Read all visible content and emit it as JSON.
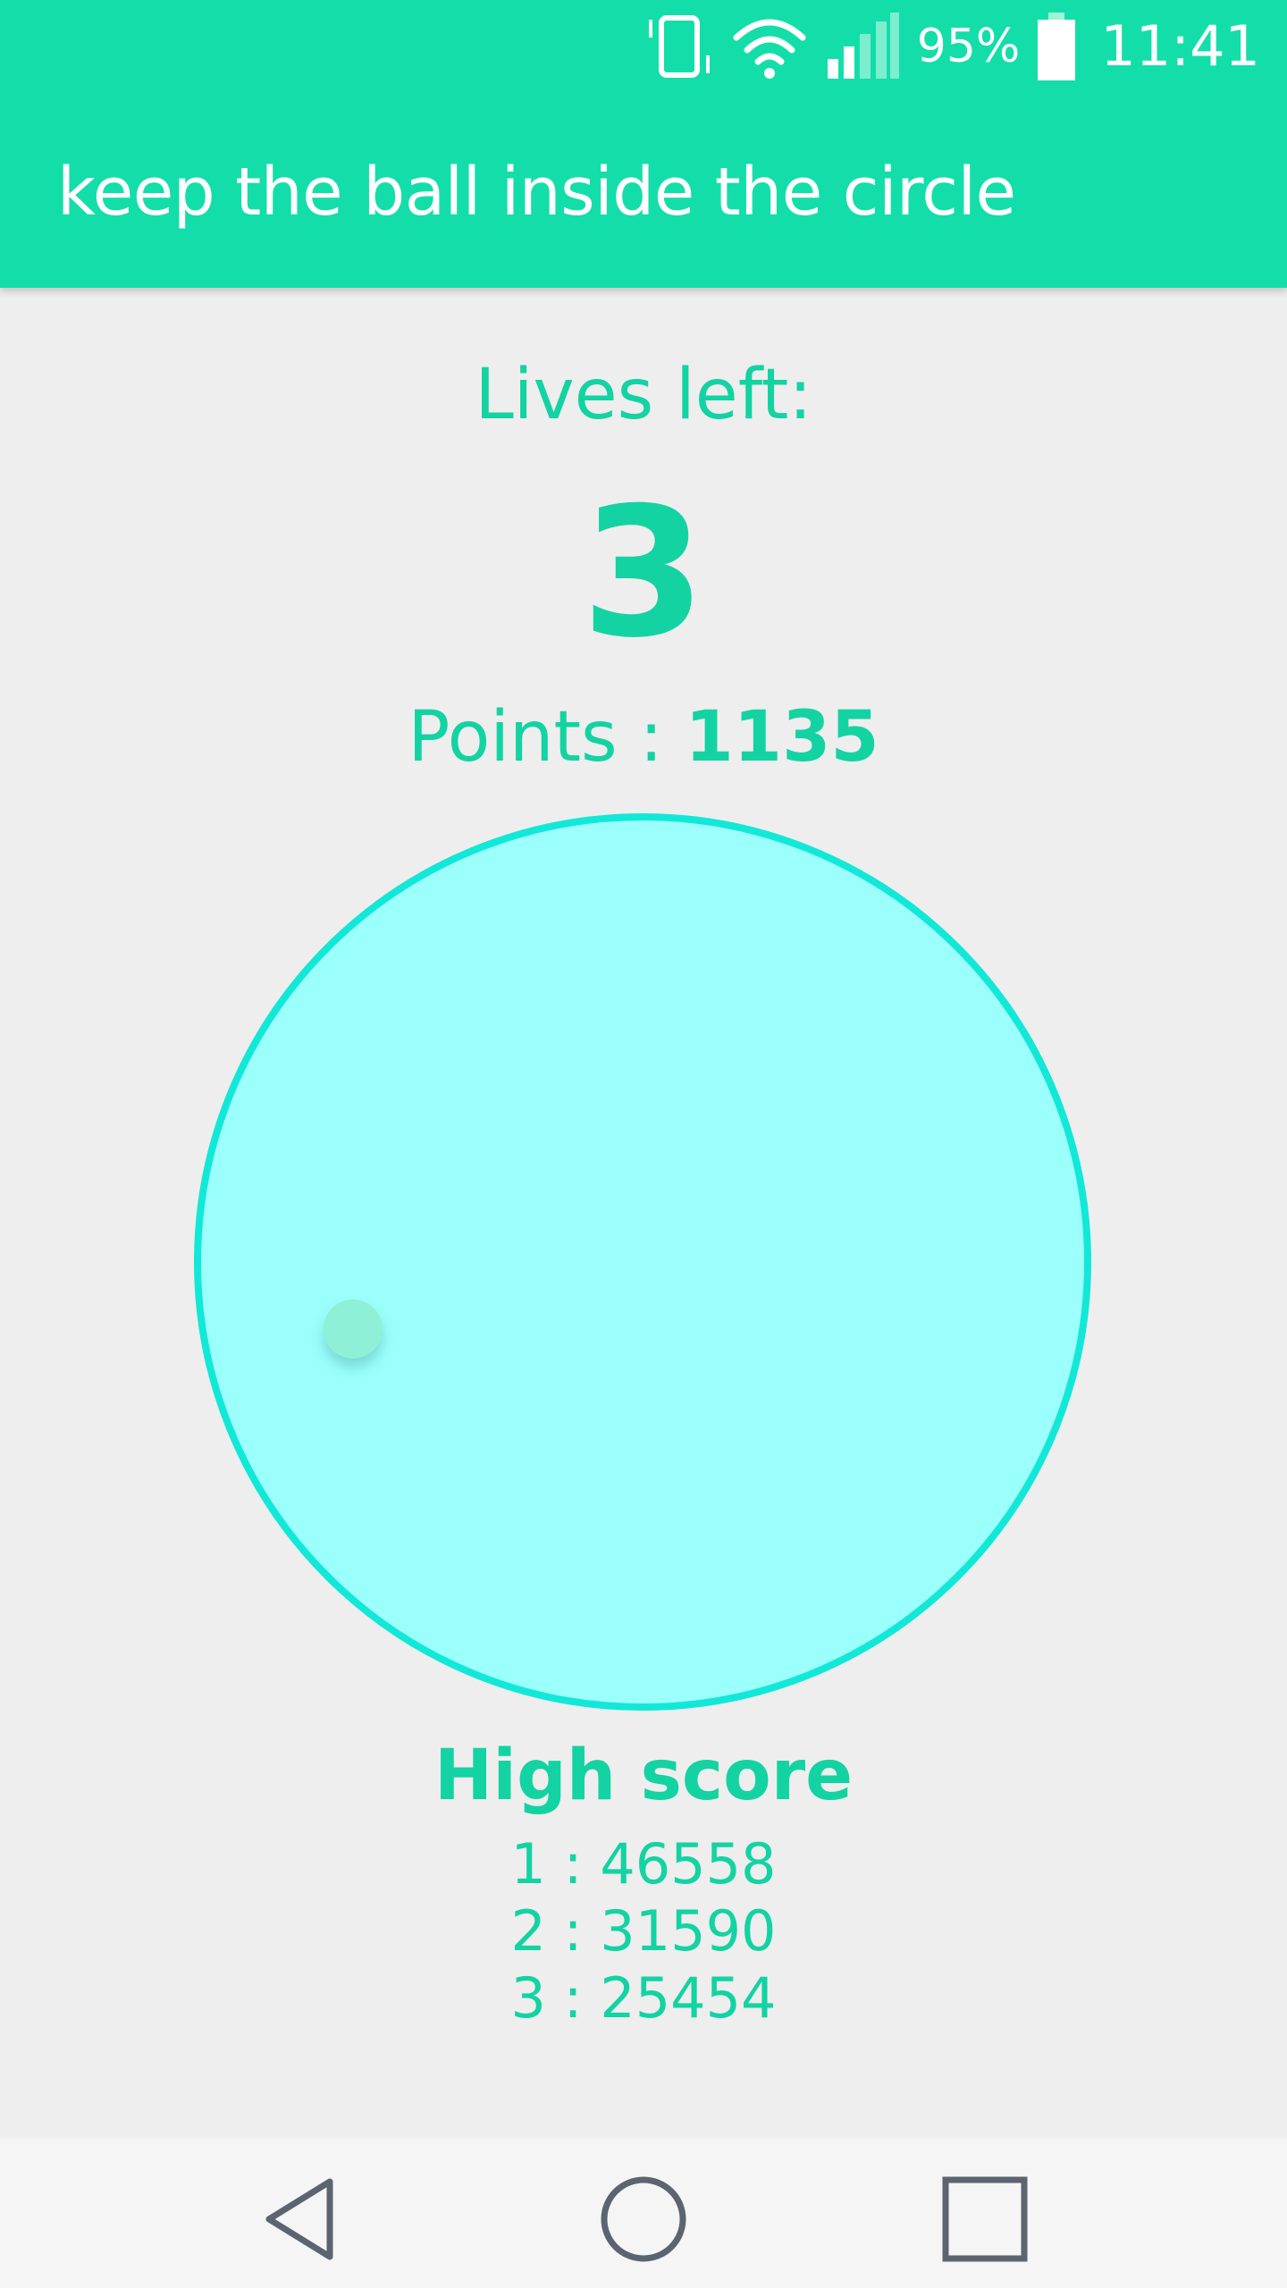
{
  "status_bar": {
    "battery_text": "95%",
    "time": "11:41",
    "icons": [
      "vibrate-icon",
      "wifi-icon",
      "signal-icon",
      "battery-icon"
    ]
  },
  "app_bar": {
    "title": "keep the ball inside the circle"
  },
  "game": {
    "lives_label": "Lives left:",
    "lives_value": "3",
    "points_label": "Points : ",
    "points_value": "1135"
  },
  "high_score": {
    "title": "High score",
    "entries": [
      "1 : 46558",
      "2 : 31590",
      "3 : 25454"
    ]
  },
  "nav_bar": {
    "icons": [
      "back-icon",
      "home-icon",
      "recents-icon"
    ]
  },
  "colors": {
    "accent": "#13dea9",
    "text_accent": "#13d3a2",
    "circle_fill": "#9bfffb",
    "circle_border": "#12e8d8",
    "ball": "#8ef0d6",
    "background": "#eeeeee",
    "nav_background": "#f5f5f5",
    "nav_icon": "#5b6470"
  }
}
